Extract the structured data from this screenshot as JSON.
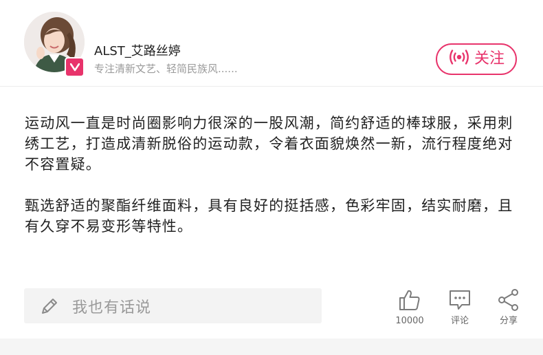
{
  "author": {
    "name": "ALST_艾路丝婷",
    "signature": "专注清新文艺、轻简民族风......",
    "avatar_icon": "user-avatar-photo",
    "badge_icon": "verified-v-badge"
  },
  "follow_button": {
    "label": "关注",
    "icon": "broadcast-icon"
  },
  "article": {
    "paragraphs": [
      "运动风一直是时尚圈影响力很深的一股风潮，简约舒适的棒球服，采用刺绣工艺，打造成清新脱俗的运动款，令着衣面貌焕然一新，流行程度绝对不容置疑。",
      "甄选舒适的聚酯纤维面料，具有良好的挺括感，色彩牢固，结实耐磨，且有久穿不易变形等特性。"
    ]
  },
  "comment_input": {
    "placeholder": "我也有话说",
    "icon": "pencil-icon"
  },
  "actions": {
    "like": {
      "count": "10000",
      "icon": "thumbs-up-icon"
    },
    "comment": {
      "label": "评论",
      "icon": "comment-bubble-icon"
    },
    "share": {
      "label": "分享",
      "icon": "share-icon"
    }
  },
  "colors": {
    "accent": "#e8336b",
    "text": "#222222",
    "muted": "#9a9a9a"
  }
}
